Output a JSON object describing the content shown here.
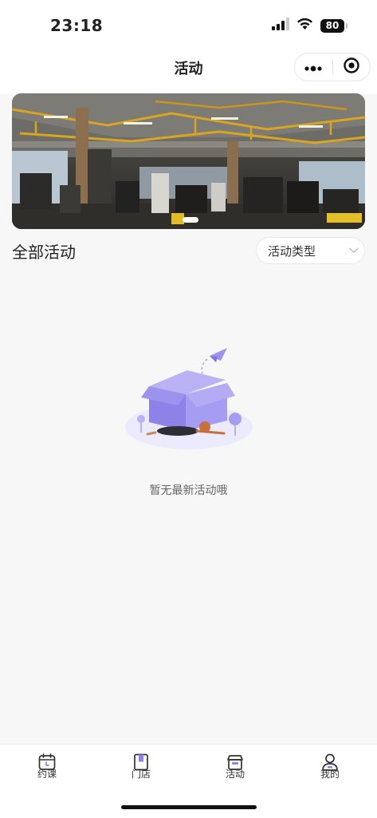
{
  "status_bar": {
    "time": "23:18",
    "battery": "80"
  },
  "nav": {
    "title": "活动"
  },
  "banner": {
    "carousel_active_index": 1,
    "carousel_count": 1
  },
  "section": {
    "title": "全部活动",
    "filter_label": "活动类型"
  },
  "empty_state": {
    "text": "暂无最新活动哦"
  },
  "tabbar": {
    "items": [
      {
        "label": "约课",
        "icon": "calendar-icon"
      },
      {
        "label": "门店",
        "icon": "store-icon"
      },
      {
        "label": "活动",
        "icon": "gift-box-icon"
      },
      {
        "label": "我的",
        "icon": "profile-icon"
      }
    ],
    "active_index": 2
  },
  "colors": {
    "accent": "#8c82e8",
    "illustration": "#a59df2"
  }
}
